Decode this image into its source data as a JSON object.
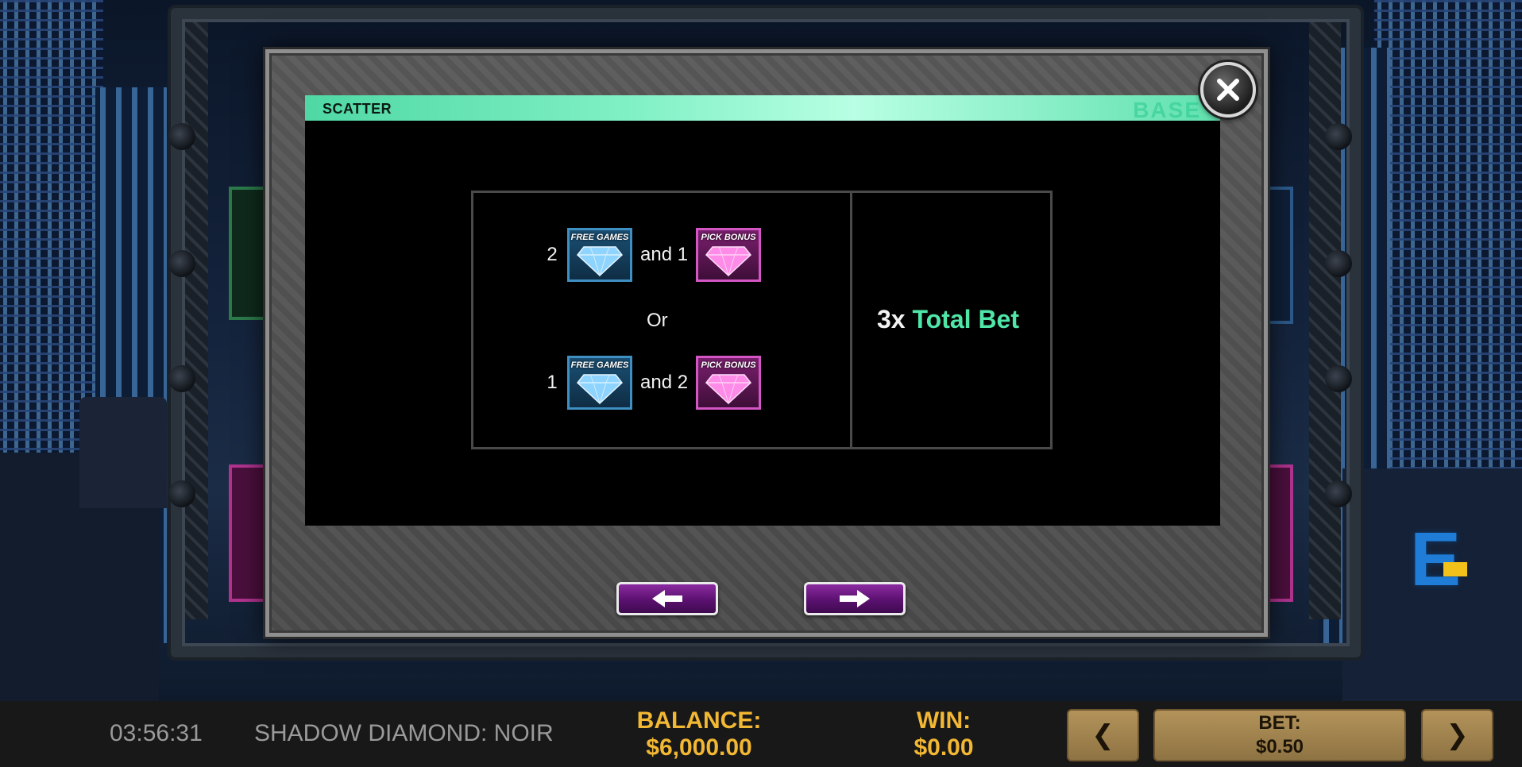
{
  "panel": {
    "title": "SCATTER",
    "tag": "BASE"
  },
  "paytable": {
    "rows": [
      {
        "count_a": "2",
        "and_text": "and 1",
        "symbol_a": "FREE GAMES",
        "symbol_b": "PICK BONUS"
      },
      {
        "count_a": "1",
        "and_text": "and 2",
        "symbol_a": "FREE GAMES",
        "symbol_b": "PICK BONUS"
      }
    ],
    "or_text": "Or",
    "payout_multiplier": "3x",
    "payout_label": "Total Bet"
  },
  "navigation": {
    "prev_icon": "arrow-left-icon",
    "next_icon": "arrow-right-icon",
    "close_icon": "close-icon"
  },
  "bottom_bar": {
    "clock": "03:56:31",
    "game_name": "SHADOW DIAMOND: NOIR",
    "balance_label": "BALANCE:",
    "balance_value": "$6,000.00",
    "win_label": "WIN:",
    "win_value": "$0.00",
    "bet_label": "BET:",
    "bet_value": "$0.50",
    "bet_prev_icon": "chevron-left-icon",
    "bet_next_icon": "chevron-right-icon"
  },
  "colors": {
    "header_accent": "#4fd8a4",
    "total_bet_text": "#4fe6a8",
    "gold_text": "#f2b733",
    "nav_button": "#5b1170",
    "free_games_gem": "#3f8fc2",
    "pick_bonus_gem": "#d455c4"
  }
}
